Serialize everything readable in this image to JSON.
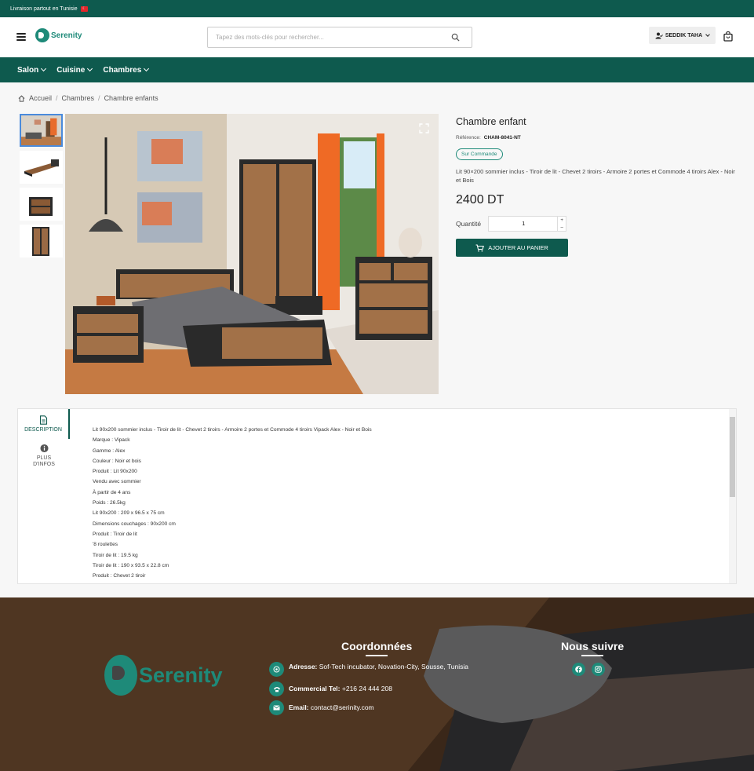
{
  "topbar": {
    "text": "Livraison partout en Tunisie"
  },
  "header": {
    "logo_text": "Serenity",
    "search_placeholder": "Tapez des mots-clés pour rechercher...",
    "user_name": "SEDDIK TAHA"
  },
  "nav": {
    "items": [
      {
        "label": "Salon"
      },
      {
        "label": "Cuisine"
      },
      {
        "label": "Chambres"
      }
    ]
  },
  "breadcrumb": {
    "items": [
      "Accueil",
      "Chambres",
      "Chambre enfants"
    ]
  },
  "product": {
    "title": "Chambre enfant",
    "reference_label": "Référence:",
    "reference": "CHAM-8041-NT",
    "badge": "Sur Commande",
    "description": "Lit 90×200 sommier inclus - Tiroir de lit - Chevet 2 tiroirs - Armoire 2 portes et Commode 4 tiroirs Alex - Noir et Bois",
    "price": "2400 DT",
    "quantity_label": "Quantité",
    "quantity": "1",
    "add_to_cart": "AJOUTER AU PANIER"
  },
  "tabs": {
    "description_label": "DESCRIPTION",
    "more_info_label_1": "PLUS",
    "more_info_label_2": "D'INFOS",
    "lines": [
      "Lit 90x200 sommier inclus - Tiroir de lit - Chevet 2 tiroirs - Armoire 2 portes et Commode 4 tiroirs Vipack Alex - Noir et Bois",
      "Marque : Vipack",
      "Gamme : Alex",
      "Couleur : Noir et bois",
      "Produit : Lit 90x200",
      "Vendu avec sommier",
      "À partir de 4 ans",
      "Poids : 26.5kg",
      "Lit 90x200 : 209 x 96.5 x 75 cm",
      "Dimensions couchages : 90x200 cm",
      "Produit : Tiroir de lit",
      "'8 roulettes",
      "Tiroir de lit : 19.5 kg",
      "Tiroir de lit : 190 x 93.5 x 22.8 cm",
      "Produit : Chevet 2 tiroir"
    ]
  },
  "footer": {
    "logo_text": "Serenity",
    "contact_title": "Coordonnées",
    "follow_title": "Nous suivre",
    "address_label": "Adresse:",
    "address": "Sof-Tech incubator, Novation-City, Sousse, Tunisia",
    "phone_label": "Commercial Tel:",
    "phone": "+216 24 444 208",
    "email_label": "Email:",
    "email": "contact@serinity.com"
  },
  "colors": {
    "primary": "#0e5a4e",
    "accent": "#1e8a79",
    "thumb_active_border": "#4a8bdc"
  },
  "icons": [
    "menu-icon",
    "search-icon",
    "user-check-icon",
    "shopping-bag-icon",
    "home-icon",
    "expand-icon",
    "cart-icon",
    "document-icon",
    "info-icon",
    "location-icon",
    "phone-icon",
    "mail-icon",
    "facebook-icon",
    "instagram-icon"
  ]
}
